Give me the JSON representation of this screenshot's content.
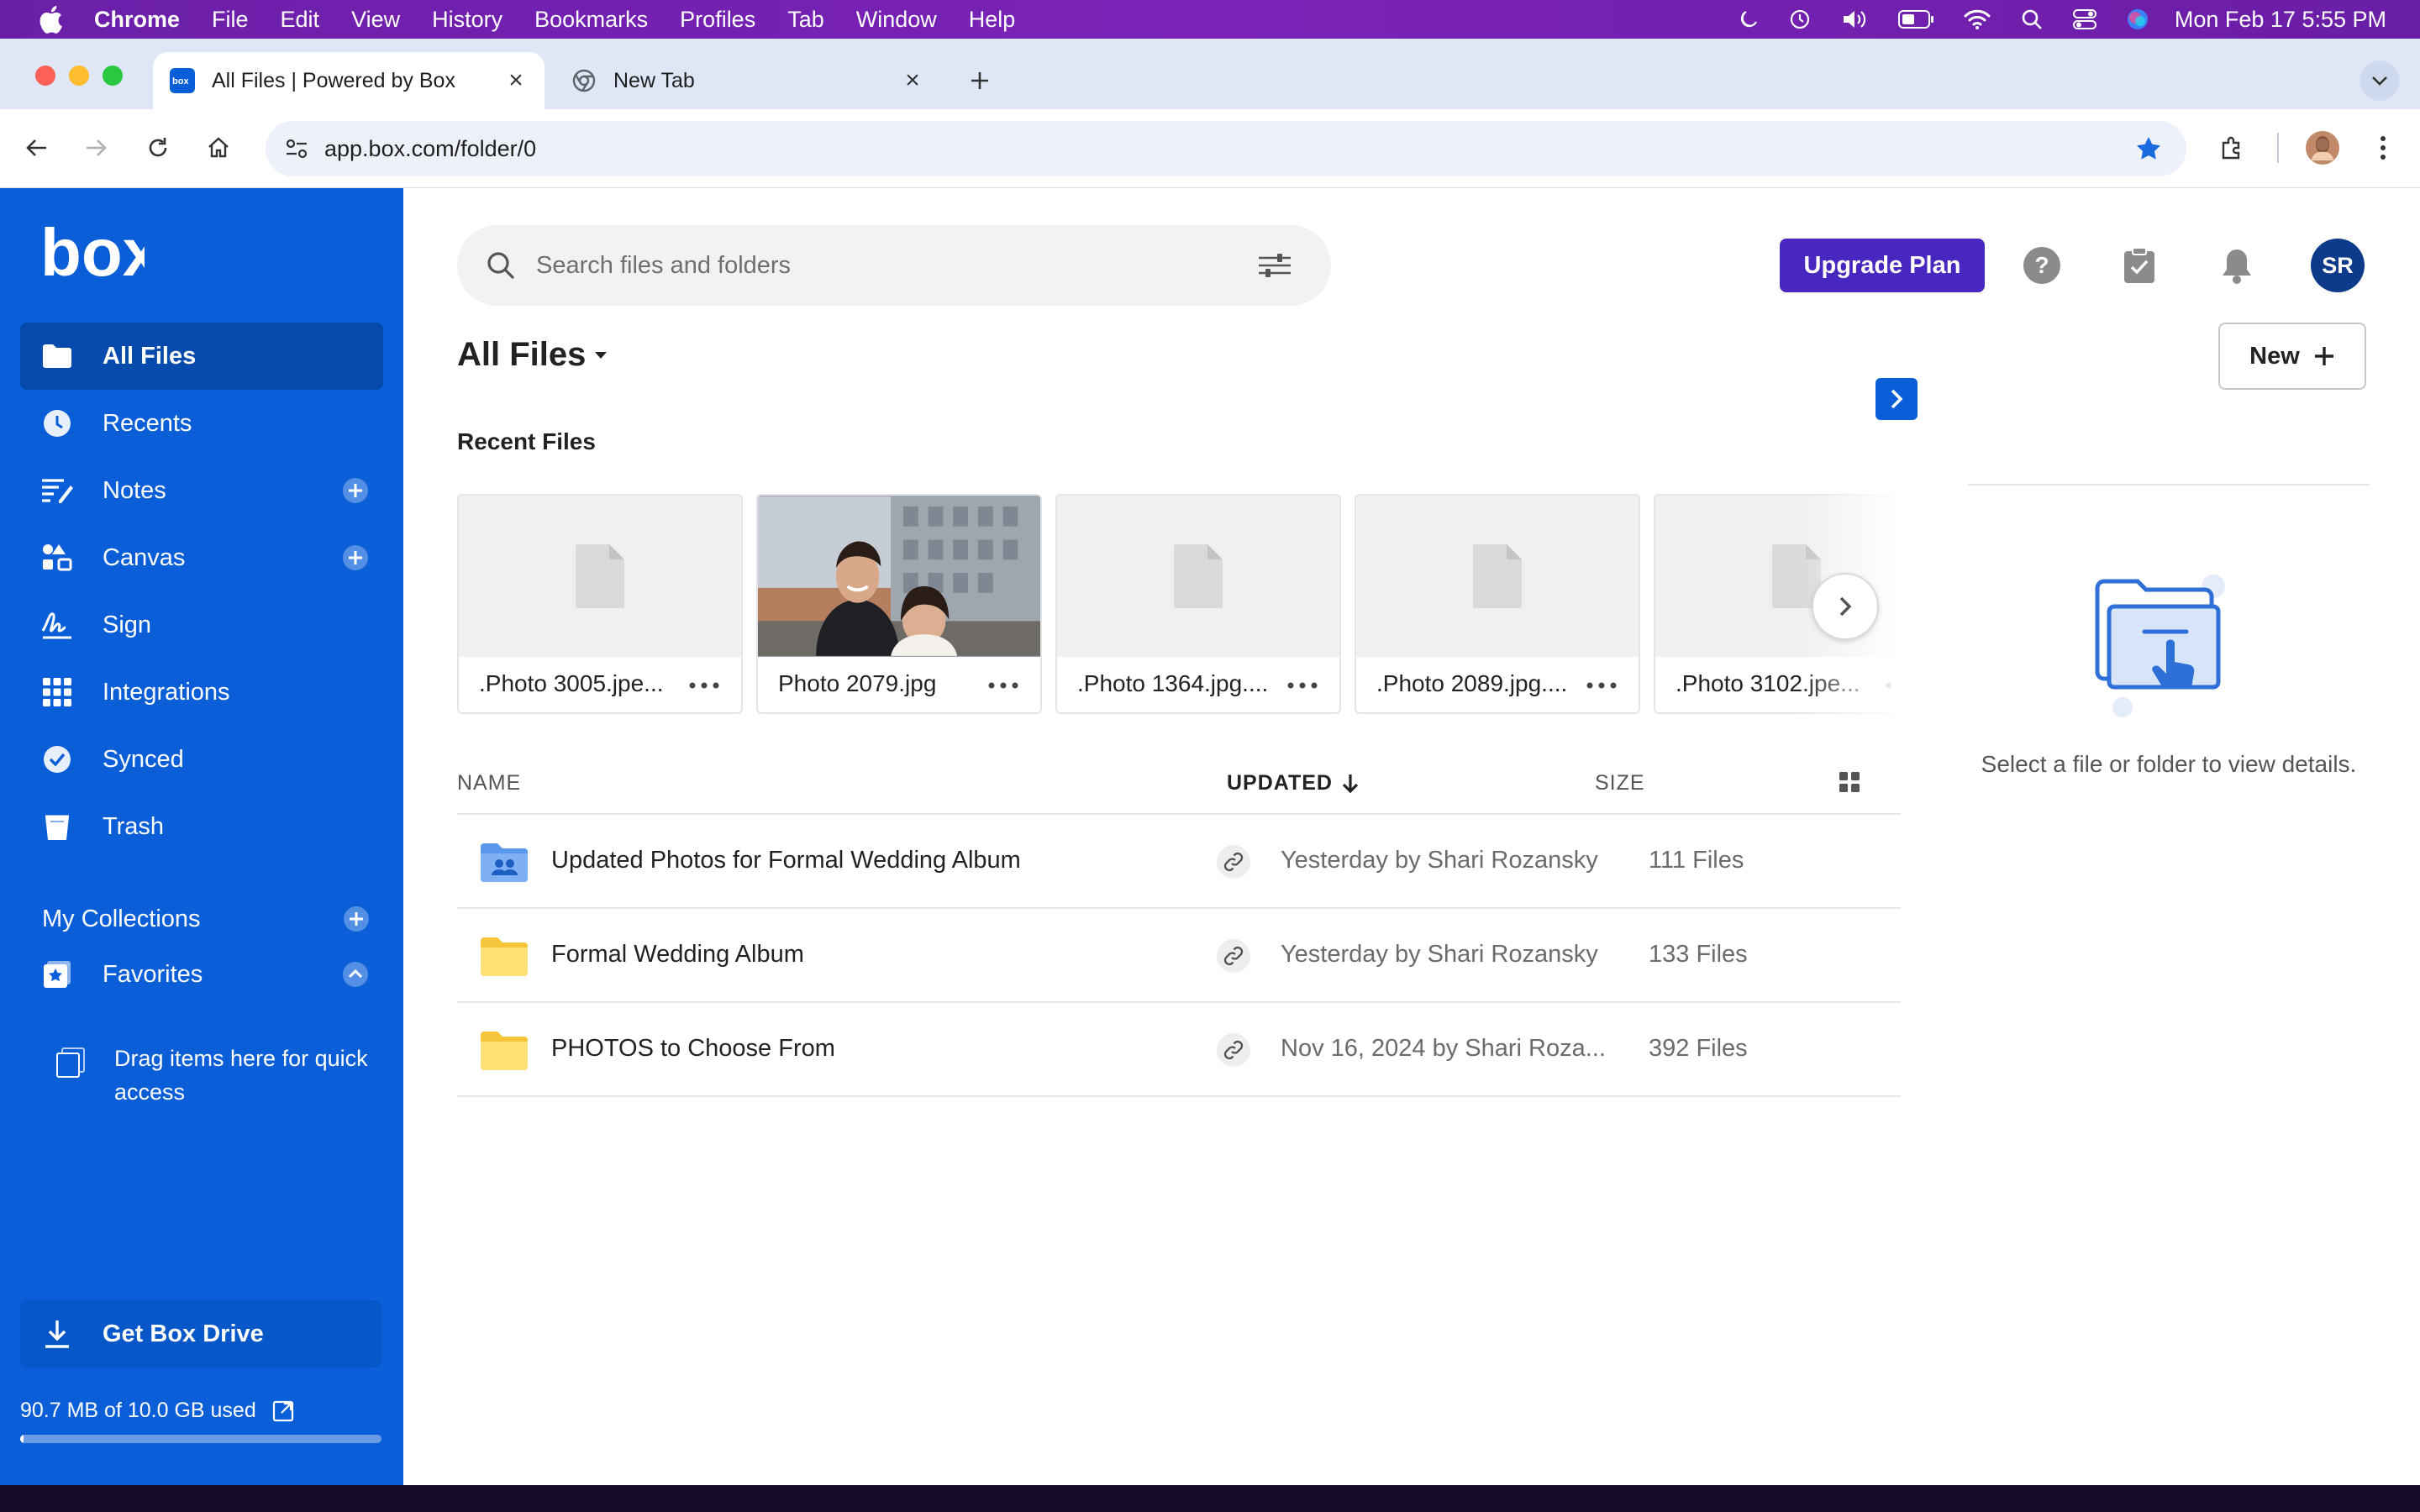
{
  "menubar": {
    "app": "Chrome",
    "items": [
      "File",
      "Edit",
      "View",
      "History",
      "Bookmarks",
      "Profiles",
      "Tab",
      "Window",
      "Help"
    ],
    "clock": "Mon Feb 17  5:55 PM"
  },
  "browser": {
    "tabs": [
      {
        "title": "All Files | Powered by Box"
      },
      {
        "title": "New Tab"
      }
    ],
    "url": "app.box.com/folder/0"
  },
  "sidebar": {
    "logo": "box",
    "items": [
      {
        "label": "All Files",
        "icon": "folder-icon"
      },
      {
        "label": "Recents",
        "icon": "clock-icon"
      },
      {
        "label": "Notes",
        "icon": "notes-icon"
      },
      {
        "label": "Canvas",
        "icon": "canvas-icon"
      },
      {
        "label": "Sign",
        "icon": "sign-icon"
      },
      {
        "label": "Integrations",
        "icon": "grid-icon"
      },
      {
        "label": "Synced",
        "icon": "check-circle-icon"
      },
      {
        "label": "Trash",
        "icon": "trash-icon"
      }
    ],
    "collections_label": "My Collections",
    "favorites_label": "Favorites",
    "drag_hint": "Drag items here for quick access",
    "get_drive": "Get Box Drive",
    "storage_text": "90.7 MB of 10.0 GB used",
    "storage_fraction": 0.009
  },
  "header": {
    "search_placeholder": "Search files and folders",
    "upgrade": "Upgrade Plan",
    "avatar": "SR"
  },
  "page": {
    "title": "All Files",
    "new_button": "New",
    "recent_label": "Recent Files"
  },
  "recent_files": [
    {
      "name": ".Photo 3005.jpe...",
      "thumb": "file"
    },
    {
      "name": "Photo 2079.jpg",
      "thumb": "photo"
    },
    {
      "name": ".Photo 1364.jpg....",
      "thumb": "file"
    },
    {
      "name": ".Photo 2089.jpg....",
      "thumb": "file"
    },
    {
      "name": ".Photo 3102.jpe...",
      "thumb": "file"
    }
  ],
  "list": {
    "columns": {
      "name": "NAME",
      "updated": "UPDATED",
      "size": "SIZE"
    },
    "rows": [
      {
        "name": "Updated Photos for Formal Wedding Album",
        "updated": "Yesterday by Shari Rozansky",
        "size": "111 Files",
        "type": "shared-folder"
      },
      {
        "name": "Formal Wedding Album",
        "updated": "Yesterday by Shari Rozansky",
        "size": "133 Files",
        "type": "folder"
      },
      {
        "name": "PHOTOS to Choose From",
        "updated": "Nov 16, 2024 by Shari Roza...",
        "size": "392 Files",
        "type": "folder"
      }
    ]
  },
  "details": {
    "message": "Select a file or folder to view details."
  },
  "colors": {
    "sidebar": "#0a5fd8",
    "upgrade": "#4826c0",
    "avatar": "#0d3a8a",
    "folder": "#fcd34d",
    "menubar": "#7a22b8"
  }
}
